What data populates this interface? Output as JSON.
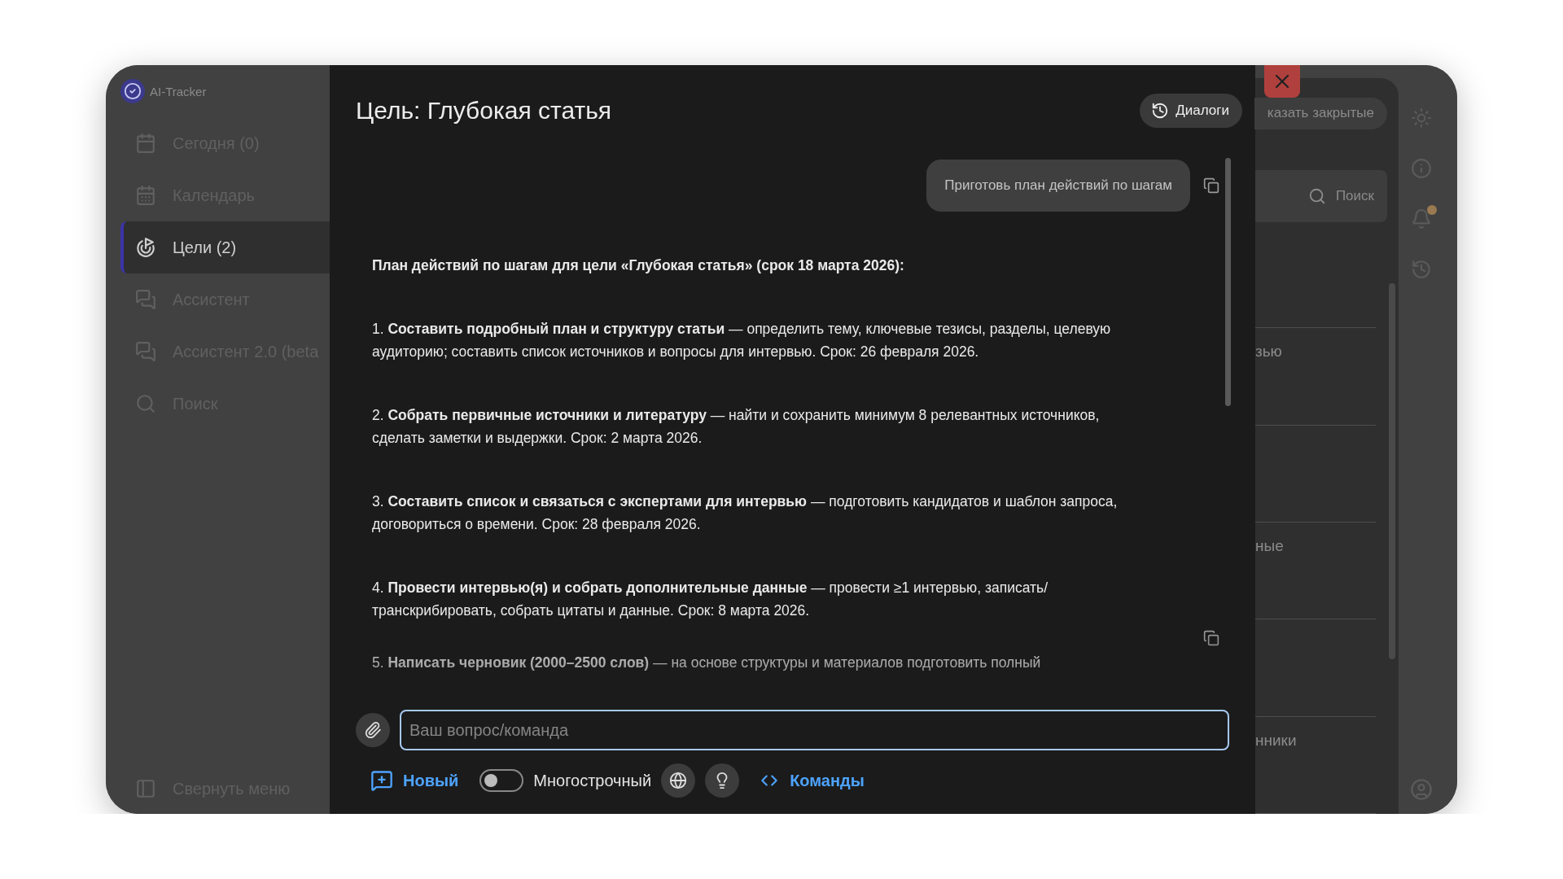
{
  "app": {
    "name": "AI-Tracker"
  },
  "sidebar": {
    "items": [
      {
        "label": "Сегодня (0)",
        "kind": "today",
        "selected": false
      },
      {
        "label": "Календарь",
        "kind": "calendar",
        "selected": false
      },
      {
        "label": "Цели (2)",
        "kind": "goals",
        "selected": true
      },
      {
        "label": "Ассистент",
        "kind": "chat",
        "selected": false
      },
      {
        "label": "Ассистент 2.0 (beta",
        "kind": "chat",
        "selected": false
      },
      {
        "label": "Поиск",
        "kind": "search",
        "selected": false
      }
    ],
    "collapse": "Свернуть меню"
  },
  "dialog": {
    "title": "Цель: Глубокая статья",
    "history_button": "Диалоги",
    "messages": [
      {
        "kind": "question",
        "text": "Приготовь план действий по шагам"
      },
      {
        "kind": "answer",
        "paragraphs": [
          "**План действий по шагам для цели «Глубокая статья» (срок 18 марта 2026):**",
          "1. **Составить подробный план и структуру статьи** — определить тему, ключевые тезисы, разделы, целевую аудиторию; составить список источников и вопросы для интервью. Срок: 26 февраля 2026.",
          "2. **Собрать первичные источники и литературу** — найти и сохранить минимум 8 релевантных источников, сделать заметки и выдержки. Срок: 2 марта 2026.",
          "3. **Составить список и связаться с экспертами для интервью** — подготовить кандидатов и шаблон запроса, договориться о времени. Срок: 28 февраля 2026.",
          "4. **Провести интервью(я) и собрать дополнительные данные** — провести ≥1 интервью, записать/ транскрибировать, собрать цитаты и данные. Срок: 8 марта 2026.",
          "5. **Написать черновик (2000–2500 слов)** — на основе структуры и материалов подготовить полный"
        ]
      }
    ],
    "input": {
      "placeholder": "Ваш вопрос/команда"
    },
    "toolbar": {
      "new_button": "Новый",
      "multiline": {
        "label": "Многострочный",
        "on": false
      },
      "commands_button": "Команды"
    }
  },
  "background": {
    "show_closed_button": "казать закрытые",
    "search_placeholder": "Поиск",
    "list_rows": [
      {
        "kind": "blank"
      },
      {
        "kind": "titled",
        "title": "зью"
      },
      {
        "kind": "blank"
      },
      {
        "kind": "titled",
        "title": "ные"
      },
      {
        "kind": "blank"
      },
      {
        "kind": "titled",
        "title": "нники"
      }
    ]
  }
}
